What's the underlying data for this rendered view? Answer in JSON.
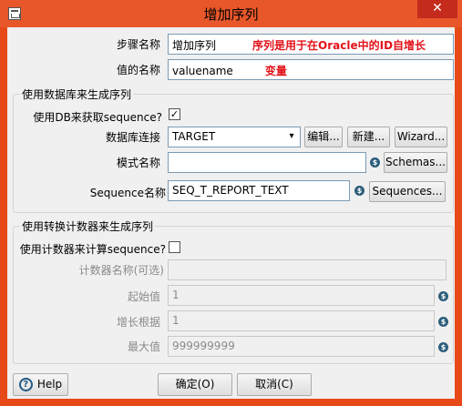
{
  "window": {
    "title": "增加序列",
    "close_glyph": "✕"
  },
  "step_name": {
    "label": "步骤名称",
    "value": "增加序列",
    "note": "序列是用于在Oracle中的ID自增长"
  },
  "value_name": {
    "label": "值的名称",
    "value": "valuename",
    "note": "变量"
  },
  "db_group": {
    "title": "使用数据库来生成序列",
    "use_db_label": "使用DB来获取sequence?",
    "use_db_checked": true,
    "connection_label": "数据库连接",
    "connection_value": "TARGET",
    "edit_button": "编辑...",
    "new_button": "新建...",
    "wizard_button": "Wizard...",
    "schema_label": "模式名称",
    "schema_value": "",
    "schemas_button": "Schemas...",
    "sequence_label": "Sequence名称",
    "sequence_value": "SEQ_T_REPORT_TEXT",
    "sequences_button": "Sequences..."
  },
  "counter_group": {
    "title": "使用转换计数器来生成序列",
    "use_counter_label": "使用计数器来计算sequence?",
    "use_counter_checked": false,
    "counter_name_label": "计数器名称(可选)",
    "counter_name_value": "",
    "start_label": "起始值",
    "start_value": "1",
    "increment_label": "增长根据",
    "increment_value": "1",
    "max_label": "最大值",
    "max_value": "999999999"
  },
  "footer": {
    "help_icon": "?",
    "help_button": "Help",
    "ok_button": "确定(O)",
    "cancel_button": "取消(C)"
  },
  "colors": {
    "title_bar": "#e8572a",
    "note_red": "#e3121a",
    "variable_icon": "#2d5d7b"
  }
}
